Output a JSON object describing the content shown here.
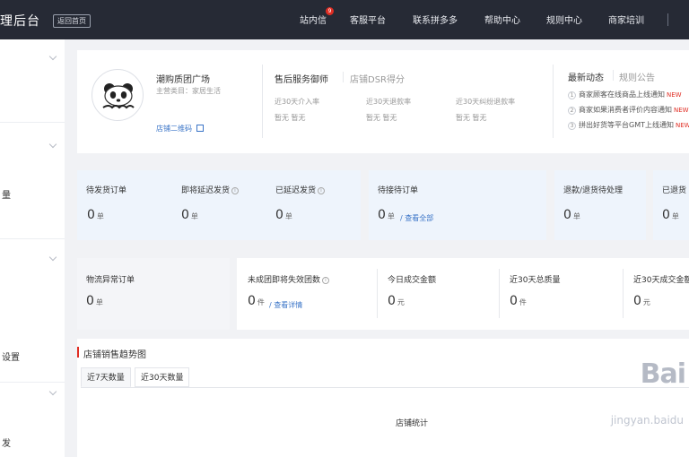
{
  "header": {
    "brand": "理后台",
    "brand_tag": "返回首页",
    "nav": [
      {
        "label": "站内信",
        "badge": "9"
      },
      {
        "label": "客服平台"
      },
      {
        "label": "联系拼多多"
      },
      {
        "label": "帮助中心"
      },
      {
        "label": "规则中心"
      },
      {
        "label": "商家培训"
      }
    ]
  },
  "sidebar": {
    "items": [
      "量",
      "",
      "设置",
      "发"
    ]
  },
  "shop": {
    "name": "潮购质团广场",
    "meta": "主营类目：家居生活",
    "qr_link": "店铺二维码"
  },
  "service": {
    "title": "售后服务御师",
    "subtitle": "店铺DSR得分",
    "metrics": [
      {
        "label": "近30天介入率",
        "value": "暂无 暂无"
      },
      {
        "label": "近30天退款率",
        "value": "暂无 暂无"
      },
      {
        "label": "近30天纠纷退款率",
        "value": "暂无 暂无"
      }
    ]
  },
  "news": {
    "title": "最新动态",
    "tab": "规则公告",
    "items": [
      "商家顾客在线商品上线通知",
      "商家如果消费者评价内容通知",
      "拼出好货等平台GMT上线通知"
    ],
    "new_label": "NEW"
  },
  "orders": [
    {
      "label": "待发货订单",
      "value": "0",
      "unit": "单"
    },
    {
      "label": "即将延迟发货",
      "value": "0",
      "unit": "单",
      "info": true
    },
    {
      "label": "已延迟发货",
      "value": "0",
      "unit": "单",
      "info": true
    },
    {
      "label": "待接待订单",
      "value": "0",
      "unit": "单",
      "link": "查看全部"
    },
    {
      "label": "退款/退货待处理",
      "value": "0",
      "unit": "单"
    },
    {
      "label": "已退货",
      "value": "0",
      "unit": "单"
    }
  ],
  "stats": [
    {
      "label": "物流异常订单",
      "value": "0",
      "unit": "单"
    },
    {
      "label": "未成团即将失效团数",
      "value": "0",
      "unit": "件",
      "info": true,
      "link": "查看详情"
    },
    {
      "label": "今日成交金额",
      "value": "0",
      "unit": "元"
    },
    {
      "label": "近30天总质量",
      "value": "0",
      "unit": "件"
    },
    {
      "label": "近30天成交金额",
      "value": "0",
      "unit": "元"
    }
  ],
  "sales": {
    "title": "店铺销售趋势图",
    "tabs": [
      "近7天数量",
      "近30天数量"
    ],
    "chart_caption": "店铺统计"
  },
  "watermark": {
    "main": "Bai",
    "sub": "jingyan.baidu"
  }
}
